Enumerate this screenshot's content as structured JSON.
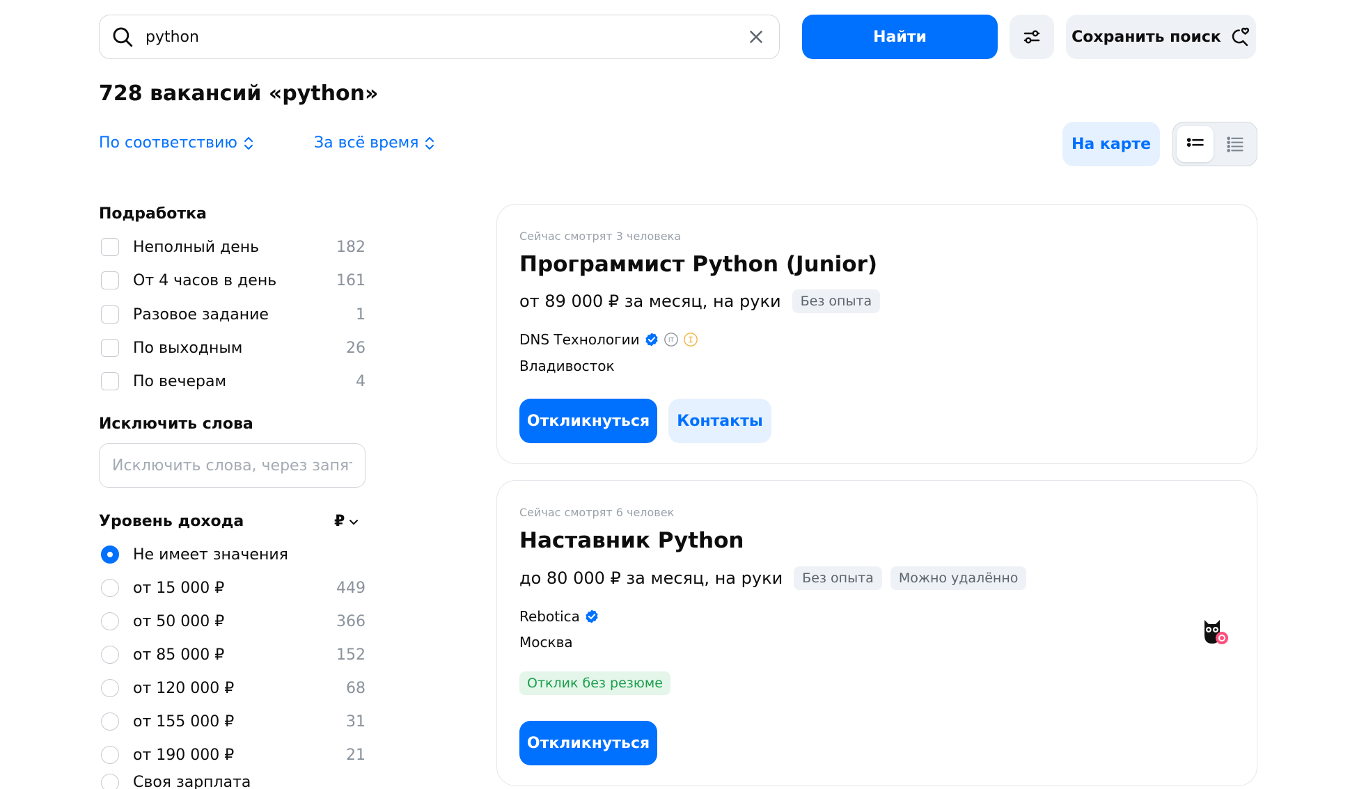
{
  "search": {
    "value": "python",
    "find_label": "Найти",
    "save_label": "Сохранить поиск"
  },
  "results": {
    "title": "728 вакансий «python»"
  },
  "sort": {
    "relevance_label": "По соответствию",
    "period_label": "За всё время",
    "map_label": "На карте"
  },
  "sidebar": {
    "parttime": {
      "heading": "Подработка",
      "items": [
        {
          "label": "Неполный день",
          "count": "182"
        },
        {
          "label": "От 4 часов в день",
          "count": "161"
        },
        {
          "label": "Разовое задание",
          "count": "1"
        },
        {
          "label": "По выходным",
          "count": "26"
        },
        {
          "label": "По вечерам",
          "count": "4"
        }
      ]
    },
    "exclude": {
      "heading": "Исключить слова",
      "placeholder": "Исключить слова, через запят..."
    },
    "income": {
      "heading": "Уровень дохода",
      "currency": "₽",
      "items": [
        {
          "label": "Не имеет значения",
          "count": "",
          "selected": true
        },
        {
          "label": "от 15 000 ₽",
          "count": "449",
          "selected": false
        },
        {
          "label": "от 50 000 ₽",
          "count": "366",
          "selected": false
        },
        {
          "label": "от 85 000 ₽",
          "count": "152",
          "selected": false
        },
        {
          "label": "от 120 000 ₽",
          "count": "68",
          "selected": false
        },
        {
          "label": "от 155 000 ₽",
          "count": "31",
          "selected": false
        },
        {
          "label": "от 190 000 ₽",
          "count": "21",
          "selected": false
        },
        {
          "label": "Своя зарплата",
          "count": "",
          "selected": false
        }
      ]
    }
  },
  "vacancies": [
    {
      "watching": "Сейчас смотрят 3 человека",
      "title": "Программист Python (Junior)",
      "salary": "от 89 000 ₽ за месяц, на руки",
      "tags": [
        "Без опыта"
      ],
      "company": "DNS Технологии",
      "city": "Владивосток",
      "apply_label": "Откликнуться",
      "contacts_label": "Контакты"
    },
    {
      "watching": "Сейчас смотрят 6 человек",
      "title": "Наставник Python",
      "salary": "до 80 000 ₽ за месяц, на руки",
      "tags": [
        "Без опыта",
        "Можно удалённо"
      ],
      "company": "Rebotica",
      "city": "Москва",
      "no_resume_label": "Отклик без резюме",
      "apply_label": "Откликнуться"
    }
  ],
  "colors": {
    "accent": "#0070ff",
    "accent_soft": "#e6f1ff",
    "muted": "#8a929c",
    "green": "#1b9e4b"
  }
}
